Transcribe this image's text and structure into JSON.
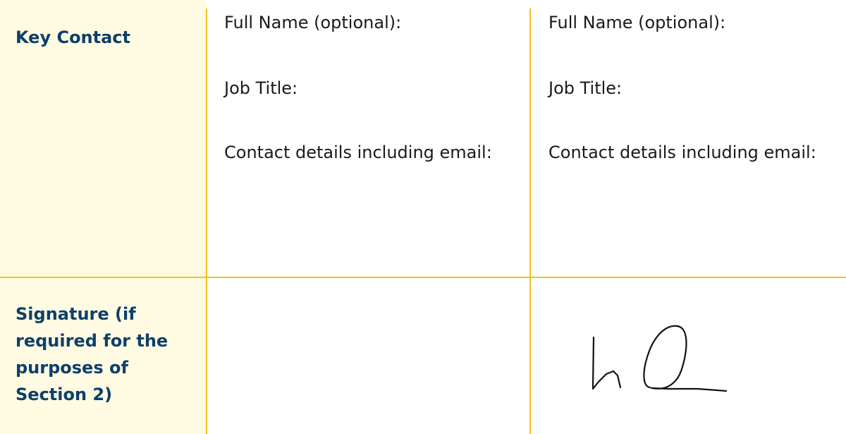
{
  "rows": {
    "key_contact": {
      "label": "Key Contact"
    },
    "signature": {
      "label": "Signature (if required for the purposes of Section 2)"
    }
  },
  "columns": [
    {
      "full_name_label": "Full Name (optional):",
      "job_title_label": "Job Title:",
      "contact_label": "Contact details including email:"
    },
    {
      "full_name_label": "Full Name (optional):",
      "job_title_label": "Job Title:",
      "contact_label": "Contact details including email:"
    }
  ],
  "colors": {
    "border": "#f2c21c",
    "label_background": "#fffbe2",
    "label_text": "#0d3f6a"
  }
}
